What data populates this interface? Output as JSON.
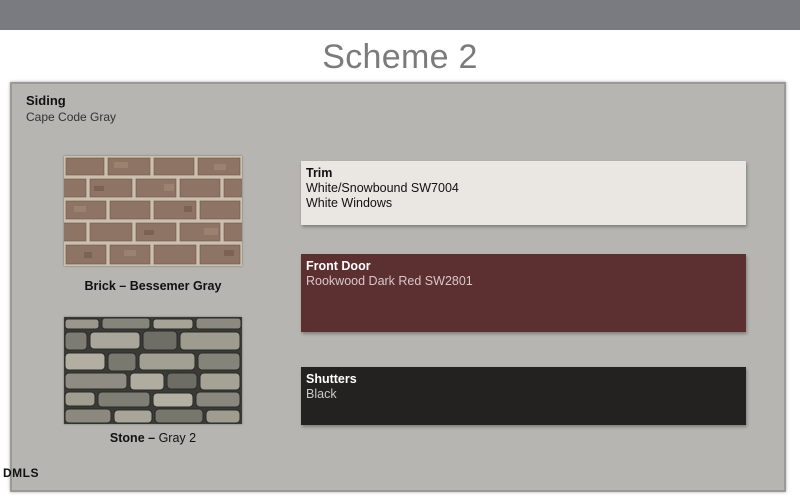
{
  "title": "Scheme 2",
  "siding": {
    "label": "Siding",
    "value": "Cape Code Gray"
  },
  "materials": [
    {
      "name": "Brick",
      "separator": " – ",
      "detail": "Bessemer Gray",
      "icon": "brick-texture"
    },
    {
      "name": "Stone",
      "separator": " – ",
      "detail": "Gray 2",
      "icon": "stone-texture"
    }
  ],
  "trim": {
    "title": "Trim",
    "lines": [
      "White/Snowbound SW7004",
      "White Windows"
    ]
  },
  "front_door": {
    "title": "Front Door",
    "lines": [
      "Rookwood Dark Red SW2801"
    ]
  },
  "shutters": {
    "title": "Shutters",
    "lines": [
      "Black"
    ]
  },
  "watermark": "DMLS",
  "colors": {
    "topbar": "#7a7b80",
    "panel": "#b6b5b1",
    "trim": "#eae7e2",
    "front_door": "#5c3031",
    "shutters": "#232221"
  }
}
